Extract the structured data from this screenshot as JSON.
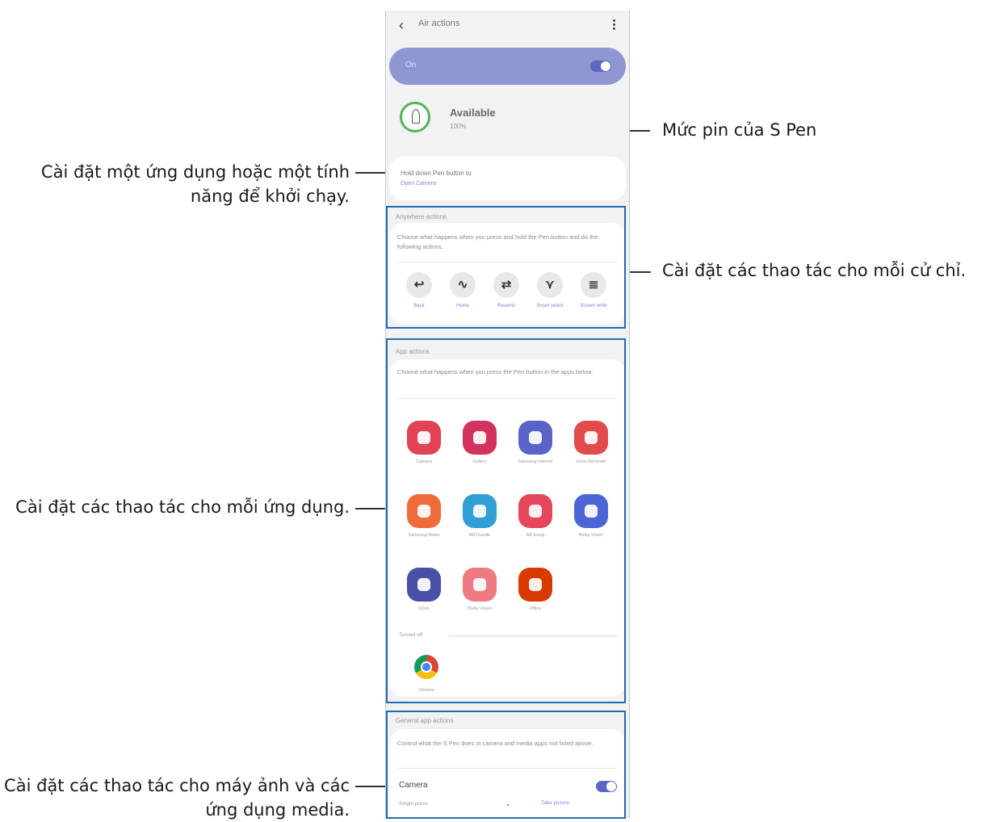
{
  "screen": {
    "title": "Air actions",
    "on_label": "On",
    "status": "Available",
    "battery": "100%",
    "hold_title": "Hold down Pen button to",
    "hold_value": "Open Camera",
    "anywhere_title": "Anywhere actions",
    "anywhere_desc": "Choose what happens when you press and hold the Pen button and do the following actions.",
    "gestures": [
      {
        "label": "Back",
        "icon": "gesture-back-icon",
        "glyph": "↩"
      },
      {
        "label": "Home",
        "icon": "gesture-home-icon",
        "glyph": "∿"
      },
      {
        "label": "Recents",
        "icon": "gesture-recents-icon",
        "glyph": "⇄"
      },
      {
        "label": "Smart select",
        "icon": "gesture-smart-select-icon",
        "glyph": "⋎"
      },
      {
        "label": "Screen write",
        "icon": "gesture-screen-write-icon",
        "glyph": "≣"
      }
    ],
    "app_title": "App actions",
    "app_desc": "Choose what happens when you press the Pen button in the apps below.",
    "apps": [
      {
        "label": "Camera",
        "icon": "camera-app-icon",
        "color": "#e04454"
      },
      {
        "label": "Gallery",
        "icon": "gallery-app-icon",
        "color": "#d3325e"
      },
      {
        "label": "Samsung Internet",
        "icon": "samsung-internet-app-icon",
        "color": "#5a63c7"
      },
      {
        "label": "Voice Recorder",
        "icon": "voice-recorder-app-icon",
        "color": "#e24b4b"
      },
      {
        "label": "Samsung Notes",
        "icon": "samsung-notes-app-icon",
        "color": "#ef6b3c"
      },
      {
        "label": "AR Doodle",
        "icon": "ar-doodle-app-icon",
        "color": "#2f9fd5"
      },
      {
        "label": "AR Emoji",
        "icon": "ar-emoji-app-icon",
        "color": "#e4475c"
      },
      {
        "label": "Bixby Vision",
        "icon": "bixby-vision-app-icon",
        "color": "#4d64d6"
      },
      {
        "label": "Clock",
        "icon": "clock-app-icon",
        "color": "#4a4fa8"
      },
      {
        "label": "Bixby Vision",
        "icon": "kids-app-icon",
        "color": "#ee7b84"
      },
      {
        "label": "Office",
        "icon": "office-app-icon",
        "color": "#d83b01"
      }
    ],
    "turned_off": "Turned off",
    "off_apps": [
      {
        "label": "Chrome",
        "icon": "chrome-app-icon"
      }
    ],
    "general_title": "General app actions",
    "general_desc": "Control what the S Pen does in camera and media apps not listed above.",
    "camera_label": "Camera",
    "single_press": "Single press",
    "take_picture": "Take picture"
  },
  "callouts": {
    "battery": "Mức pin của S Pen",
    "hold": "Cài đặt một ứng dụng hoặc một tính năng để khởi chạy.",
    "gestures": "Cài đặt các thao tác cho mỗi cử chỉ.",
    "apps": "Cài đặt các thao tác cho mỗi ứng dụng.",
    "media": "Cài đặt các thao tác cho máy ảnh và các ứng dụng media."
  }
}
